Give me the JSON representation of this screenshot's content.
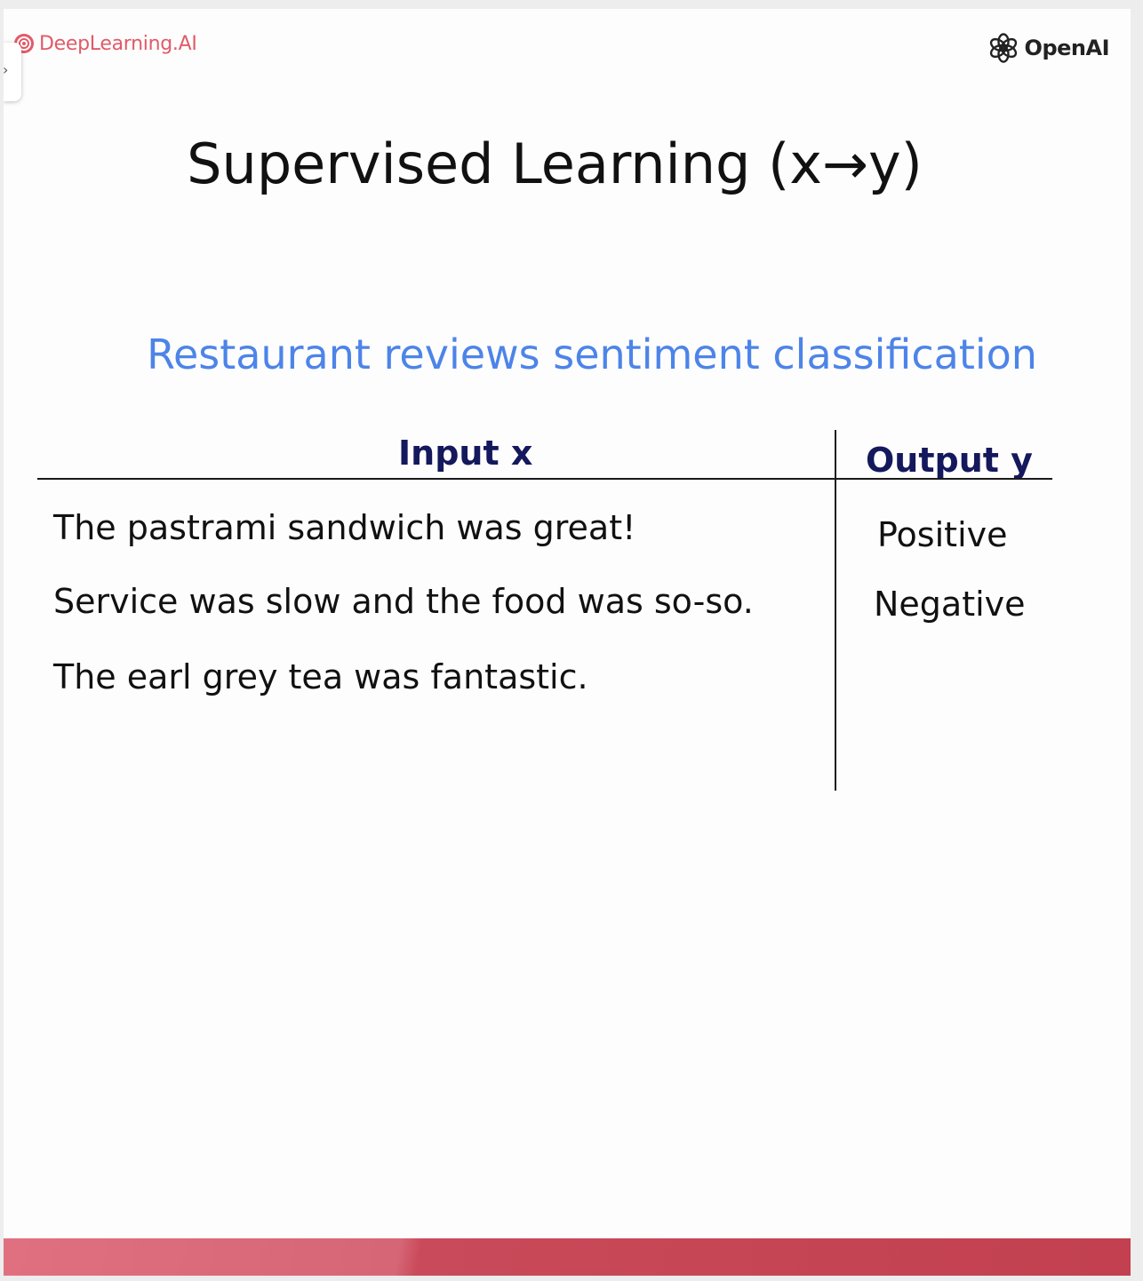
{
  "header": {
    "left_brand": "DeepLearning.AI",
    "right_brand": "OpenAI"
  },
  "slide": {
    "title": "Supervised Learning (x→y)",
    "subtitle": "Restaurant reviews sentiment classification"
  },
  "table": {
    "headers": {
      "input": "Input x",
      "output": "Output y"
    },
    "rows": [
      {
        "input": "The pastrami sandwich was great!",
        "output": "Positive"
      },
      {
        "input": "Service was slow and the food was so-so.",
        "output": "Negative"
      },
      {
        "input": "The earl grey tea was fantastic.",
        "output": ""
      }
    ]
  },
  "colors": {
    "brand_red": "#e25a68",
    "subtitle_blue": "#4d84e8",
    "header_navy": "#14185c",
    "footer_band": "#c2404f"
  },
  "icons": {
    "side_tab": "chevron-right-icon",
    "left_logo": "deeplearning-logo-icon",
    "right_logo": "openai-logo-icon"
  }
}
